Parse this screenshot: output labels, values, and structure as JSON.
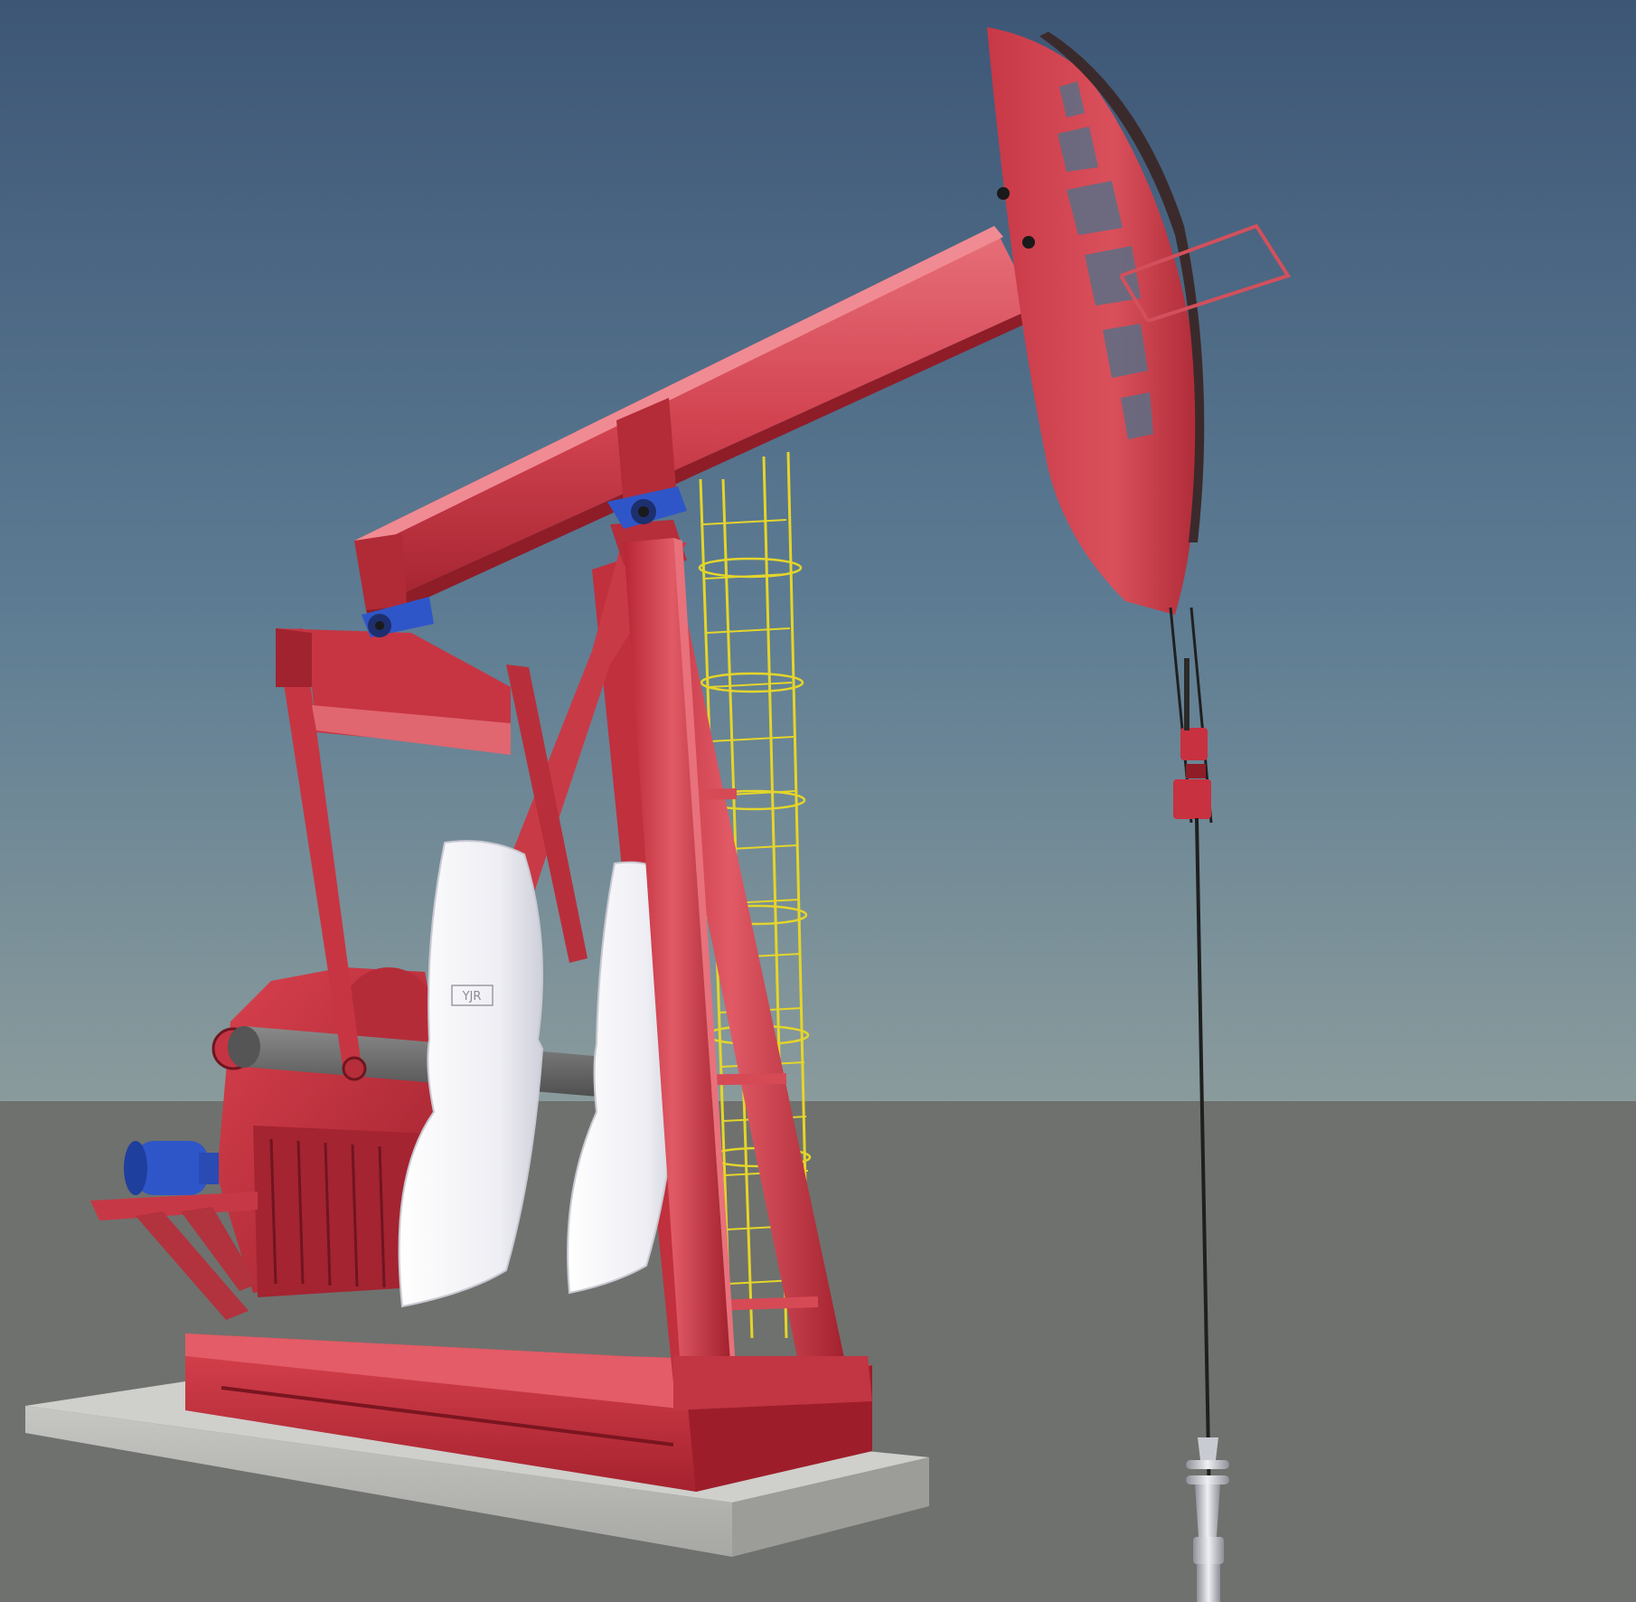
{
  "scene": {
    "subject": "pumpjack",
    "components": [
      "sky",
      "ground",
      "concrete-base",
      "skid-base",
      "samson-post",
      "walking-beam",
      "horsehead",
      "equalizer",
      "pitman-arms",
      "crank",
      "counterweights",
      "gearbox",
      "motor",
      "ladder",
      "bridle",
      "carrier-bar",
      "polished-rod",
      "wellhead"
    ]
  },
  "colors": {
    "sky_top": "#3f5a78",
    "sky_bottom": "#86999c",
    "ground": "#6f716e",
    "red": "#c8313f",
    "red_light": "#e0606a",
    "red_dark": "#8e1d28",
    "counterweight": "#f2f2f6",
    "crank": "#6a6a6a",
    "blue": "#2f56c8",
    "ladder": "#e4d52a",
    "concrete": "#b5b5b2",
    "rod": "#2a2a2a",
    "steel": "#c9cbd2"
  },
  "counterweights": {
    "marking": "YJR"
  }
}
